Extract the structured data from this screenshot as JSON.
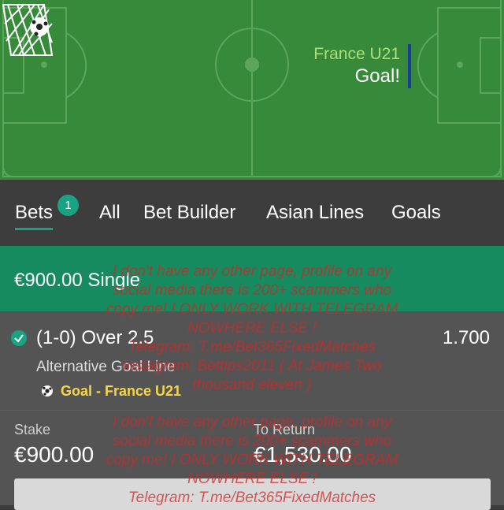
{
  "pitch": {
    "team": "France U21",
    "event": "Goal!"
  },
  "tabs": [
    {
      "label": "Bets",
      "active": true,
      "badge": "1"
    },
    {
      "label": "All"
    },
    {
      "label": "Bet Builder"
    },
    {
      "label": "Asian Lines"
    },
    {
      "label": "Goals"
    }
  ],
  "bet": {
    "summary": "€900.00 Single",
    "selection": "(1-0) Over 2.5",
    "odds": "1.700",
    "market": "Alternative Goal Line",
    "event_line": "Goal - France U21",
    "stake_label": "Stake",
    "stake_value": "€900.00",
    "return_label": "To Return",
    "return_value": "€1,530.00"
  },
  "watermark": {
    "block1": [
      "I don't have any other page, profile on any",
      "social media there is 200+ scammers who",
      "copy me! I ONLY WORK WITH TELEGRAM",
      "NOWHERE ELSE !",
      "Telegram: T.me/Bet365FixedMatches",
      "Instagram: Bettips2011 ( At James Two",
      "thousand eleven )"
    ],
    "block2": [
      "I don't have any other page, profile on any",
      "social media there is 200+ scammers who",
      "copy me! I ONLY WORK WITH TELEGRAM",
      "NOWHERE ELSE !",
      "Telegram: T.me/Bet365FixedMatches"
    ]
  },
  "colors": {
    "pitch": "#388a3b",
    "accent": "#18a484",
    "summary_bg": "#168b5f",
    "team_text": "#a9e07c",
    "event_text": "#f6d64a",
    "watermark": "#cd2828"
  },
  "icons": {
    "check": "check-circle-icon",
    "ball": "football-icon",
    "net": "goal-net-icon"
  }
}
